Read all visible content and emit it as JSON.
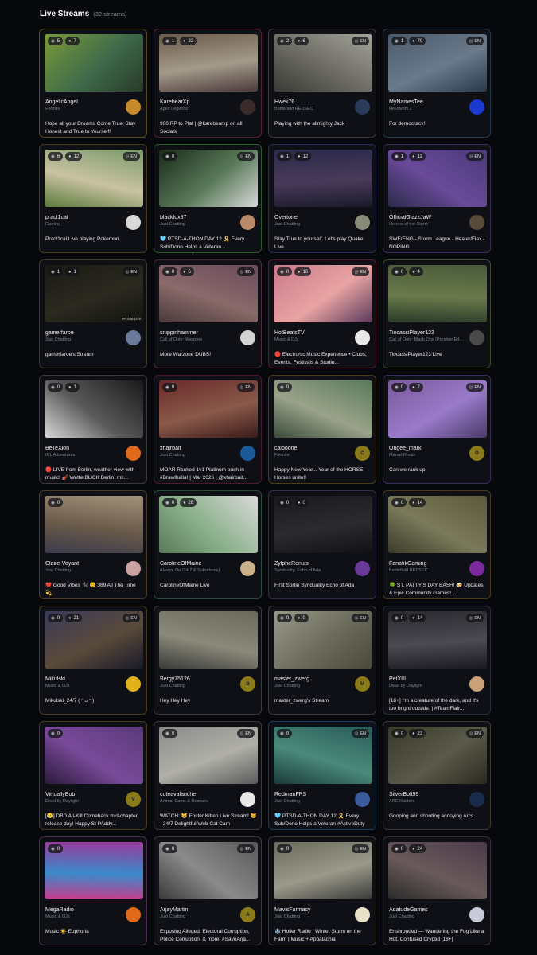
{
  "header": {
    "title": "Live Streams",
    "count": "(32 streams)"
  },
  "icons": {
    "viewers": "eye-icon",
    "chat": "people-icon",
    "language": "globe-icon"
  },
  "streams": [
    {
      "name": "AngelicAngel",
      "game": "Fortnite",
      "title": "Hope all your Dreams Come True! Stay Honest and True to Yourself!",
      "viewers": "5",
      "chatters": "7",
      "lang": "",
      "border": "#5a4a1a",
      "thumb": [
        "#7a9a3a",
        "#3e6a4a",
        "#2a3a2a"
      ],
      "avatar": {
        "letter": "",
        "bg": "#c98a2a",
        "fg": "#1a1a1a"
      }
    },
    {
      "name": "KarebearXp",
      "game": "Apex Legends",
      "title": "900 RP to Plat | @karebearxp on all Socials",
      "viewers": "1",
      "chatters": "22",
      "lang": "",
      "border": "#5a1f2e",
      "thumb": [
        "#6a5a4a",
        "#a49a8a",
        "#4a3a3a"
      ],
      "avatar": {
        "letter": "",
        "bg": "#3a2a2a",
        "fg": "#ffffff"
      }
    },
    {
      "name": "Hwek76",
      "game": "Battlefield REDSEC",
      "title": "Playing with the allmighty Jack",
      "viewers": "2",
      "chatters": "6",
      "lang": "EN",
      "border": "#3a3a3a",
      "thumb": [
        "#a3a39a",
        "#6a6a62",
        "#3a3a36"
      ],
      "avatar": {
        "letter": "",
        "bg": "#2a3a5a",
        "fg": "#ffffff"
      }
    },
    {
      "name": "MyNamesTee",
      "game": "Helldivers 2",
      "title": "For democracy!",
      "viewers": "1",
      "chatters": "79",
      "lang": "EN",
      "border": "#1f3a4a",
      "thumb": [
        "#4a5a6a",
        "#6a7a8a",
        "#2a3a4a"
      ],
      "avatar": {
        "letter": "",
        "bg": "#1a3acf",
        "fg": "#ffffff"
      }
    },
    {
      "name": "pract1cal",
      "game": "Gaming",
      "title": "Pract1cal Live playing Pokemon",
      "viewers": "6",
      "chatters": "12",
      "lang": "EN",
      "border": "#4a3a1a",
      "thumb": [
        "#7a9a6a",
        "#c9c2a2",
        "#5a7a3a"
      ],
      "avatar": {
        "letter": "",
        "bg": "#d8d8d8",
        "fg": "#1a1a1a"
      }
    },
    {
      "name": "blackfox87",
      "game": "Just Chatting",
      "title": "🩵 PTSD-A-THON DAY 12 🎗️ Every Sub/Dono Helps a Veteran...",
      "viewers": "0",
      "chatters": "",
      "lang": "EN",
      "border": "#2a5a2a",
      "thumb": [
        "#1a2a1a",
        "#5a7a5a",
        "#d9d9d9"
      ],
      "avatar": {
        "letter": "",
        "bg": "#b98a6a",
        "fg": "#1a1a1a"
      }
    },
    {
      "name": "Overtone",
      "game": "Just Chatting",
      "title": "Stay True to yourself. Let's play Quake Live",
      "viewers": "1",
      "chatters": "12",
      "lang": "",
      "border": "#2a2a5a",
      "thumb": [
        "#2a2a4a",
        "#4a3a5a",
        "#1a1a2a"
      ],
      "avatar": {
        "letter": "",
        "bg": "#8a8a7a",
        "fg": "#1a1a1a"
      }
    },
    {
      "name": "OfficialGlazzJaW",
      "game": "Heroes of the Storm",
      "title": "SWE/ENG - Storm League - Healer/Flex - NOPING",
      "viewers": "1",
      "chatters": "11",
      "lang": "EN",
      "border": "#3a2a5a",
      "thumb": [
        "#4a3a7a",
        "#6a4a9a",
        "#2a2a4a"
      ],
      "avatar": {
        "letter": "",
        "bg": "#5a4a3a",
        "fg": "#ffffff"
      }
    },
    {
      "name": "gamerfaroe",
      "game": "Just Chatting",
      "title": "gamerfaroe's Stream",
      "viewers": "1",
      "chatters": "1",
      "lang": "EN",
      "border": "#3a3a2a",
      "thumb": [
        "#1a1a14",
        "#2a2a20",
        "#141410"
      ],
      "avatar": {
        "letter": "",
        "bg": "#6a7a9a",
        "fg": "#ffffff"
      },
      "wm": "PRISM Live"
    },
    {
      "name": "snippinhammer",
      "game": "Call of Duty: Warzone",
      "title": "More Warzone DUBS!",
      "viewers": "0",
      "chatters": "6",
      "lang": "EN",
      "border": "#4a2a3a",
      "thumb": [
        "#6a4a5a",
        "#8a6a6a",
        "#4a3a3a"
      ],
      "avatar": {
        "letter": "",
        "bg": "#d2d2d2",
        "fg": "#1a1a1a"
      }
    },
    {
      "name": "HotBeatsTV",
      "game": "Music & DJs",
      "title": "🔴 Electronic Music Experience • Clubs, Events, Festivals & Studio...",
      "viewers": "0",
      "chatters": "16",
      "lang": "EN",
      "border": "#5a1a2a",
      "thumb": [
        "#c97a8a",
        "#e9a3a3",
        "#5a3a5a"
      ],
      "avatar": {
        "letter": "",
        "bg": "#e8e8e8",
        "fg": "#c01a1a"
      }
    },
    {
      "name": "TiocassiPlayer123",
      "game": "Call of Duty: Black Ops (Prestige Ed...",
      "title": "TiocassiPlayer123 Live",
      "viewers": "0",
      "chatters": "4",
      "lang": "",
      "border": "#3a4a2a",
      "thumb": [
        "#4a5a3a",
        "#6a7a4a",
        "#2a3a2a"
      ],
      "avatar": {
        "letter": "",
        "bg": "#4a4a4a",
        "fg": "#ffffff"
      }
    },
    {
      "name": "BeTeXion",
      "game": "IRL Adventures",
      "title": "🔴 LIVE from Berlin, weather view with music! 🎻 WetterBLiCK Berlin, mit...",
      "viewers": "0",
      "chatters": "1",
      "lang": "",
      "border": "#3a3a3a",
      "thumb": [
        "#1a1a1a",
        "#5a5a5a",
        "#d9d9d9"
      ],
      "avatar": {
        "letter": "",
        "bg": "#e06a1a",
        "fg": "#1a1a1a"
      }
    },
    {
      "name": "xhairbait",
      "game": "Just Chatting",
      "title": "MOAR Ranked 1v1 Platinum push in #Brawlhalla! | Mar 2026 | @xhairbait...",
      "viewers": "0",
      "chatters": "",
      "lang": "EN",
      "border": "#4a1a2a",
      "thumb": [
        "#6a2a2a",
        "#8a5a4a",
        "#3a1a1a"
      ],
      "avatar": {
        "letter": "",
        "bg": "#1a5a9a",
        "fg": "#ffffff"
      }
    },
    {
      "name": "calboone",
      "game": "Fortnite",
      "title": "Happy New Year... Year of the HORSE- Horses unite!!",
      "viewers": "0",
      "chatters": "",
      "lang": "",
      "border": "#4a3a1a",
      "thumb": [
        "#5a7a5a",
        "#9aa38a",
        "#3a4a3a"
      ],
      "avatar": {
        "letter": "C",
        "bg": "#8a7a1a",
        "fg": "#1a1a1a"
      }
    },
    {
      "name": "Ohgee_mark",
      "game": "Marvel Rivals",
      "title": "Can we rank up",
      "viewers": "0",
      "chatters": "7",
      "lang": "EN",
      "border": "#3a2a5a",
      "thumb": [
        "#7a5a9a",
        "#9a7aca",
        "#4a3a6a"
      ],
      "avatar": {
        "letter": "O",
        "bg": "#8a7a1a",
        "fg": "#1a1a1a"
      }
    },
    {
      "name": "Claire-Voyant",
      "game": "Just Chatting",
      "title": "❤️ Good Vibes 🐈‍⬛ 😊 369 All The Time 💫",
      "viewers": "0",
      "chatters": "",
      "lang": "",
      "border": "#4a3a2a",
      "thumb": [
        "#a3927a",
        "#6a5a4a",
        "#3a3a4a"
      ],
      "avatar": {
        "letter": "",
        "bg": "#c9a2a2",
        "fg": "#1a1a1a"
      }
    },
    {
      "name": "CarolineOfMaine",
      "game": "Always On (24/7 & Subathons)",
      "title": "CarolineOfMaine Live",
      "viewers": "0",
      "chatters": "28",
      "lang": "",
      "border": "#2a4a3a",
      "thumb": [
        "#d9d9d9",
        "#8ab08a",
        "#5a7a5a"
      ],
      "avatar": {
        "letter": "",
        "bg": "#c9b28a",
        "fg": "#1a1a1a"
      }
    },
    {
      "name": "ZylpheRenuis",
      "game": "Synduality: Echo of Ada",
      "title": "First Sortie Synduality Echo of Ada",
      "viewers": "0",
      "chatters": "0",
      "lang": "",
      "border": "#3a2a4a",
      "thumb": [
        "#1a1a1e",
        "#2a2a30",
        "#121214"
      ],
      "avatar": {
        "letter": "",
        "bg": "#6a3a9a",
        "fg": "#ffffff"
      }
    },
    {
      "name": "FanatikGaming",
      "game": "Battlefield REDSEC",
      "title": "🍀 ST. PATTY'S DAY BASH! 🍻 Updates & Epic Community Games! ...",
      "viewers": "0",
      "chatters": "14",
      "lang": "",
      "border": "#4a3a1a",
      "thumb": [
        "#5a5a3a",
        "#7a7a5a",
        "#3a3a2a"
      ],
      "avatar": {
        "letter": "",
        "bg": "#7a2a9a",
        "fg": "#ffffff"
      }
    },
    {
      "name": "Mikulski",
      "game": "Music & DJs",
      "title": "Mikulski_24/7 ( ᵔ ᴗ ᵔ )",
      "viewers": "0",
      "chatters": "21",
      "lang": "EN",
      "border": "#4a3a1a",
      "thumb": [
        "#3a3a5a",
        "#5a4a3a",
        "#1a1a2a"
      ],
      "avatar": {
        "letter": "",
        "bg": "#e0b21a",
        "fg": "#1a1a1a"
      }
    },
    {
      "name": "Bergy75126",
      "game": "Just Chatting",
      "title": "Hey Hey Hey",
      "viewers": "",
      "chatters": "",
      "lang": "",
      "border": "#3a3a3a",
      "thumb": [
        "#6a6a5a",
        "#8a8a7a",
        "#3a3a3a"
      ],
      "avatar": {
        "letter": "B",
        "bg": "#8a7a1a",
        "fg": "#1a1a1a"
      }
    },
    {
      "name": "master_zwerg",
      "game": "Just Chatting",
      "title": "master_zwerg's Stream",
      "viewers": "0",
      "chatters": "0",
      "lang": "EN",
      "border": "#3a3a3a",
      "thumb": [
        "#9a9a8a",
        "#6a6a5a",
        "#4a4a3a"
      ],
      "avatar": {
        "letter": "M",
        "bg": "#8a7a1a",
        "fg": "#1a1a1a"
      }
    },
    {
      "name": "PetXIII",
      "game": "Dead by Daylight",
      "title": "[18+] I'm a creature of the dark, and it's too bright outside. | #TeamFlair...",
      "viewers": "0",
      "chatters": "14",
      "lang": "EN",
      "border": "#2a2a3a",
      "thumb": [
        "#2a2a30",
        "#4a4a50",
        "#1a1a20"
      ],
      "avatar": {
        "letter": "",
        "bg": "#c9a27a",
        "fg": "#1a1a1a"
      }
    },
    {
      "name": "VirtuallyBob",
      "game": "Dead by Daylight",
      "title": "[😢] DBD All-Kill Comeback mid-chapter release day! Happy St PAddy...",
      "viewers": "0",
      "chatters": "",
      "lang": "",
      "border": "#4a3a1a",
      "thumb": [
        "#5a3a7a",
        "#7a4a9a",
        "#2a1a3a"
      ],
      "avatar": {
        "letter": "V",
        "bg": "#8a7a1a",
        "fg": "#1a1a1a"
      }
    },
    {
      "name": "cuteavalanche",
      "game": "Animal Cams & Rescues",
      "title": "WATCH: 😸 Foster Kitten Live Stream! 😸 - 24/7 Delightful Web Cat Cam",
      "viewers": "0",
      "chatters": "",
      "lang": "EN",
      "border": "#3a3a3a",
      "thumb": [
        "#8a8a8a",
        "#b0b0a8",
        "#5a5a5a"
      ],
      "avatar": {
        "letter": "",
        "bg": "#e8e8e8",
        "fg": "#1a1a1a"
      }
    },
    {
      "name": "RedmanFPS",
      "game": "Just Chatting",
      "title": "🩵 PTSD-A-THON DAY 12 🎗️ Every Sub/Dono Helps a Veteran #ActiveDuty",
      "viewers": "0",
      "chatters": "",
      "lang": "EN",
      "border": "#1a3a5a",
      "thumb": [
        "#2a5a5a",
        "#4a8a7a",
        "#1a3a3a"
      ],
      "avatar": {
        "letter": "",
        "bg": "#3a5a9a",
        "fg": "#ffffff"
      }
    },
    {
      "name": "SilverBolt99",
      "game": "ARC Raiders",
      "title": "Gooping and shooting annoying Arcs",
      "viewers": "0",
      "chatters": "23",
      "lang": "EN",
      "border": "#3a3a2a",
      "thumb": [
        "#3a3a2a",
        "#5a5a4a",
        "#2a2a20"
      ],
      "avatar": {
        "letter": "",
        "bg": "#1a2a4a",
        "fg": "#ffffff"
      }
    },
    {
      "name": "MegaRadio",
      "game": "Music & DJs",
      "title": "Music ☀️ Euphoria",
      "viewers": "0",
      "chatters": "",
      "lang": "",
      "border": "#4a2a4a",
      "thumb": [
        "#9a3a9a",
        "#3a8aca",
        "#ca3a8a"
      ],
      "avatar": {
        "letter": "",
        "bg": "#e06a1a",
        "fg": "#1a1a1a"
      }
    },
    {
      "name": "ArjayMartin",
      "game": "Just Chatting",
      "title": "Exposing Alleged: Electoral Corruption, Police Corruption, & more. #SaveArja...",
      "viewers": "0",
      "chatters": "",
      "lang": "EN",
      "border": "#3a3a3a",
      "thumb": [
        "#5a5a5a",
        "#8a8a8a",
        "#3a3a3a"
      ],
      "avatar": {
        "letter": "A",
        "bg": "#8a7a1a",
        "fg": "#1a1a1a"
      }
    },
    {
      "name": "MavisFarmacy",
      "game": "Just Chatting",
      "title": "❄️ Holler Radio | Winter Storm on the Farm | Music + Appalachia",
      "viewers": "0",
      "chatters": "",
      "lang": "EN",
      "border": "#3a3a2a",
      "thumb": [
        "#6a6a5a",
        "#9a9a8a",
        "#3a3a3a"
      ],
      "avatar": {
        "letter": "",
        "bg": "#e8e0c8",
        "fg": "#1a1a1a"
      }
    },
    {
      "name": "AdatudeGames",
      "game": "Just Chatting",
      "title": "Enshrouded — Wandering the Fog Like a Hot, Confused Cryptid [18+]",
      "viewers": "0",
      "chatters": "24",
      "lang": "",
      "border": "#3a2a3a",
      "thumb": [
        "#4a3a4a",
        "#6a5a5a",
        "#2a2a2a"
      ],
      "avatar": {
        "letter": "",
        "bg": "#c9c9d9",
        "fg": "#1a1a1a"
      }
    }
  ]
}
